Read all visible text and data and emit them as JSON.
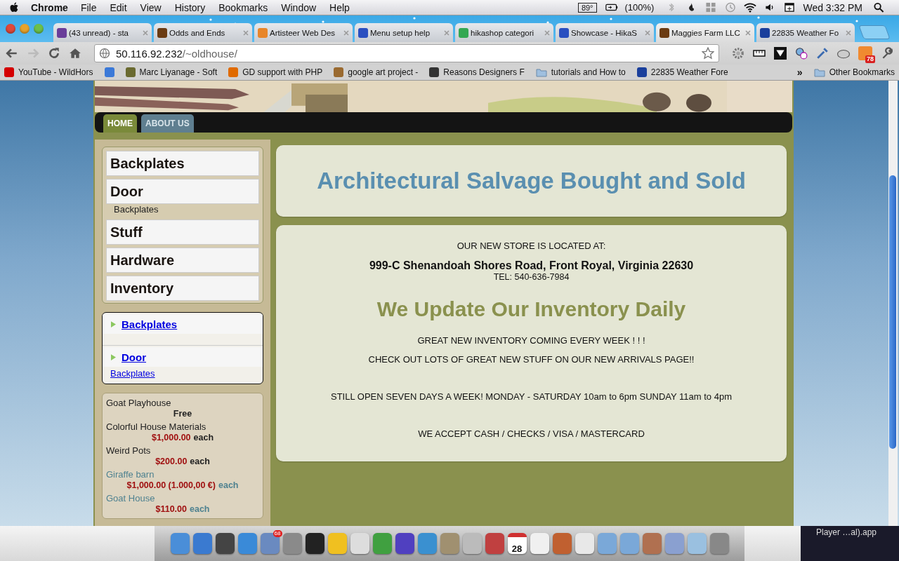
{
  "menu_bar": {
    "app": "Chrome",
    "menus": [
      "File",
      "Edit",
      "View",
      "History",
      "Bookmarks",
      "Window",
      "Help"
    ],
    "temperature": "89°",
    "battery": "(100%)",
    "clock": "Wed 3:32 PM"
  },
  "tabs": [
    {
      "label": "(43 unread) - sta",
      "selected": false
    },
    {
      "label": "Odds and Ends",
      "selected": false
    },
    {
      "label": "Artisteer Web Des",
      "selected": false
    },
    {
      "label": "Menu setup help",
      "selected": false
    },
    {
      "label": "hikashop categori",
      "selected": false
    },
    {
      "label": "Showcase - HikaS",
      "selected": false
    },
    {
      "label": "Maggies Farm LLC",
      "selected": true
    },
    {
      "label": "22835 Weather Fo",
      "selected": false
    }
  ],
  "address_bar": {
    "host": "50.116.92.232",
    "path": "/~oldhouse/"
  },
  "extension_badge": "78",
  "bookmarks": [
    {
      "label": "YouTube - WildHors"
    },
    {
      "label": "Marc Liyanage - Soft"
    },
    {
      "label": "GD support with PHP"
    },
    {
      "label": "google art project -"
    },
    {
      "label": "Reasons Designers F"
    },
    {
      "label": "tutorials and How to"
    },
    {
      "label": "22835 Weather Fore"
    }
  ],
  "bookmarks_more": "»",
  "other_bookmarks": "Other Bookmarks",
  "site": {
    "nav": [
      {
        "label": "HOME",
        "selected": true
      },
      {
        "label": "ABOUT US",
        "selected": false
      }
    ],
    "categories": [
      {
        "label": "Backplates"
      },
      {
        "label": "Door",
        "children": [
          {
            "label": "Backplates"
          }
        ]
      },
      {
        "label": "Stuff"
      },
      {
        "label": "Hardware"
      },
      {
        "label": "Inventory"
      }
    ],
    "category_links": [
      {
        "label": "Backplates"
      },
      {
        "label": "Door",
        "children": [
          {
            "label": "Backplates"
          }
        ]
      }
    ],
    "products": [
      {
        "name": "Goat Playhouse",
        "price": "Free",
        "color": "#222222"
      },
      {
        "name": "Colorful House Materials",
        "price": "$1,000.00",
        "unit": "each",
        "color": "#222222"
      },
      {
        "name": "Weird Pots",
        "price": "$200.00",
        "unit": "each",
        "color": "#222222"
      },
      {
        "name": "Giraffe barn",
        "price": "$1,000.00 (1.000,00 €)",
        "unit": "each",
        "color": "#4f8290"
      },
      {
        "name": "Goat House",
        "price": "$110.00",
        "unit": "each",
        "color": "#4f8290"
      }
    ],
    "headline": "Architectural Salvage Bought and Sold",
    "store_intro": "OUR NEW STORE IS LOCATED AT:",
    "address": "999-C Shenandoah Shores Road, Front Royal, Virginia 22630",
    "phone": "TEL: 540-636-7984",
    "subheadline": "We Update Our Inventory Daily",
    "notices": [
      "GREAT NEW INVENTORY COMING EVERY WEEK ! ! !",
      "CHECK OUT LOTS OF GREAT NEW STUFF ON OUR NEW ARRIVALS PAGE!!",
      "STILL OPEN SEVEN DAYS A WEEK! MONDAY - SATURDAY 10am to 6pm SUNDAY 11am to 4pm",
      "WE ACCEPT CASH / CHECKS / VISA / MASTERCARD"
    ]
  },
  "dock": {
    "mail_badge": "68",
    "calendar_day": "28"
  },
  "background_window": {
    "title": "Player …al).app"
  }
}
